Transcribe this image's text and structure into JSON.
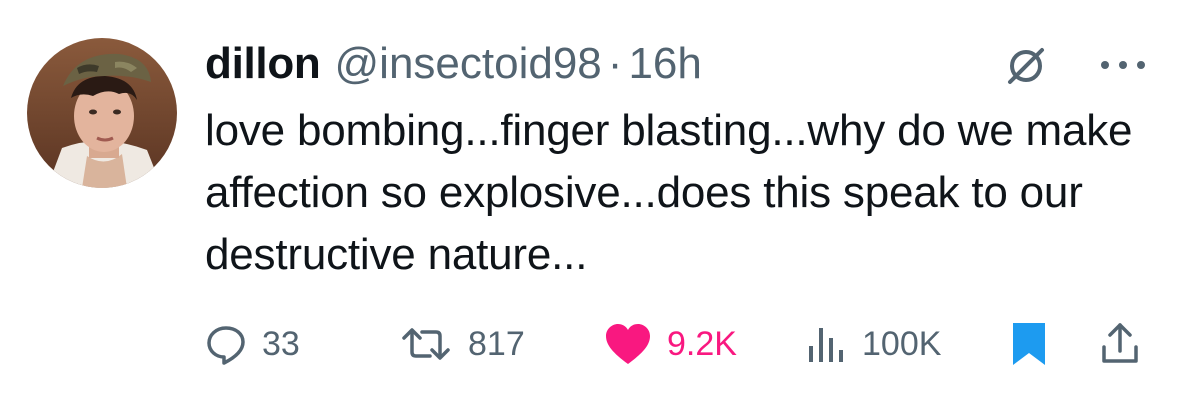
{
  "tweet": {
    "author_name": "dillon",
    "handle": "@insectoid98",
    "separator": "·",
    "time": "16h",
    "text": "love bombing...finger blasting...why do we make affection so explosive...does this speak to our destructive nature...",
    "icons": {
      "avatar": "profile-photo",
      "grok": "grok-icon",
      "more": "more-icon"
    }
  },
  "actions": {
    "replies": {
      "icon": "reply-icon",
      "count": "33"
    },
    "retweets": {
      "icon": "retweet-icon",
      "count": "817"
    },
    "likes": {
      "icon": "heart-icon",
      "count": "9.2K",
      "liked": true
    },
    "views": {
      "icon": "views-icon",
      "count": "100K"
    },
    "bookmark": {
      "icon": "bookmark-icon",
      "active": true
    },
    "share": {
      "icon": "share-icon"
    }
  },
  "colors": {
    "text": "#0f1419",
    "secondary": "#536471",
    "like": "#f91880",
    "bookmark": "#1d9bf0"
  }
}
